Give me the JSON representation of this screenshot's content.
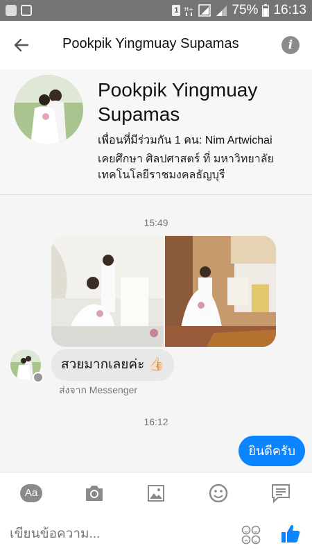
{
  "status_bar": {
    "battery": "75%",
    "time": "16:13",
    "sim": "1"
  },
  "header": {
    "title": "Pookpik Yingmuay Supamas"
  },
  "profile": {
    "name": "Pookpik Yingmuay Supamas",
    "mutual_friends": "เพื่อนที่มีร่วมกัน 1 คน: Nim Artwichai",
    "education": "เคยศึกษา ศิลปศาสตร์ ที่ มหาวิทยาลัยเทคโนโลยีราชมงคลธัญบุรี"
  },
  "messages": {
    "time_1": "15:49",
    "incoming_text": "สวยมากเลยค่ะ 👍🏻",
    "sent_via": "ส่งจาก Messenger",
    "time_2": "16:12",
    "outgoing_text": "ยินดีครับ"
  },
  "toolbar": {
    "aa_label": "Aa"
  },
  "composer": {
    "placeholder": "เขียนข้อความ..."
  },
  "colors": {
    "accent": "#0a84ff",
    "status_bar": "#757575",
    "bubble_in": "#e8e8e8"
  }
}
